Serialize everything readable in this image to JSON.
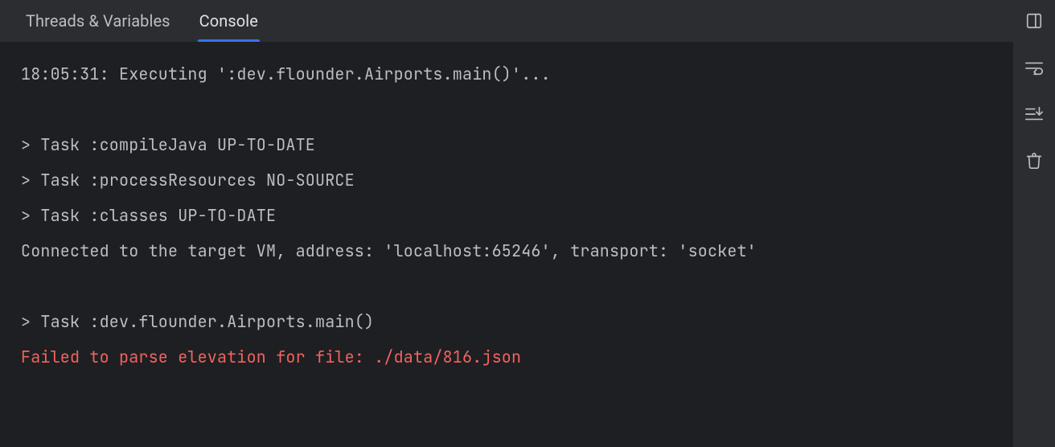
{
  "tabs": [
    {
      "label": "Threads & Variables",
      "active": false
    },
    {
      "label": "Console",
      "active": true
    }
  ],
  "console": {
    "lines": [
      {
        "text": "18:05:31: Executing ':dev.flounder.Airports.main()'...",
        "kind": "normal"
      },
      {
        "text": "",
        "kind": "normal"
      },
      {
        "text": "> Task :compileJava UP-TO-DATE",
        "kind": "normal"
      },
      {
        "text": "> Task :processResources NO-SOURCE",
        "kind": "normal"
      },
      {
        "text": "> Task :classes UP-TO-DATE",
        "kind": "normal"
      },
      {
        "text": "Connected to the target VM, address: 'localhost:65246', transport: 'socket'",
        "kind": "normal"
      },
      {
        "text": "",
        "kind": "normal"
      },
      {
        "text": "> Task :dev.flounder.Airports.main()",
        "kind": "normal"
      },
      {
        "text": "Failed to parse elevation for file: ./data/816.json",
        "kind": "err"
      }
    ]
  },
  "icons": {
    "layout": "layout-icon",
    "softwrap": "soft-wrap-icon",
    "scrollend": "scroll-to-end-icon",
    "clear": "trash-icon"
  }
}
